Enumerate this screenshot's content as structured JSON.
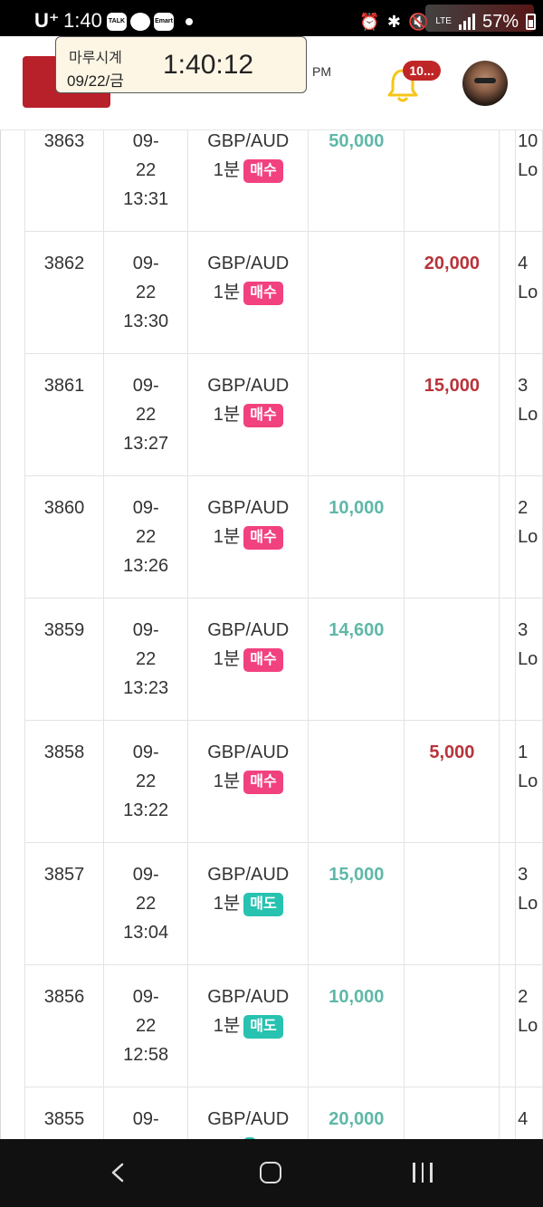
{
  "status_bar": {
    "carrier": "U⁺",
    "time": "1:40",
    "notif_icons": [
      "TALK",
      "",
      "Emart"
    ],
    "network": "LTE",
    "battery": "57%"
  },
  "header": {
    "clock_title": "마루시계",
    "clock_date": "09/22/금",
    "clock_time": "1:40:12",
    "clock_ampm": "PM",
    "notification_count": "10...",
    "accent_color": "#b8202a"
  },
  "table": {
    "rows": [
      {
        "id": "3863",
        "date_line1": "09-",
        "date_line2": "22",
        "time": "13:31",
        "pair": "GBP/AUD",
        "duration": "1분",
        "side": "매수",
        "side_type": "buy",
        "win": "50,000",
        "loss": "",
        "result_line1": "10",
        "result_line2": "Lo"
      },
      {
        "id": "3862",
        "date_line1": "09-",
        "date_line2": "22",
        "time": "13:30",
        "pair": "GBP/AUD",
        "duration": "1분",
        "side": "매수",
        "side_type": "buy",
        "win": "",
        "loss": "20,000",
        "result_line1": "4",
        "result_line2": "Lo"
      },
      {
        "id": "3861",
        "date_line1": "09-",
        "date_line2": "22",
        "time": "13:27",
        "pair": "GBP/AUD",
        "duration": "1분",
        "side": "매수",
        "side_type": "buy",
        "win": "",
        "loss": "15,000",
        "result_line1": "3",
        "result_line2": "Lo"
      },
      {
        "id": "3860",
        "date_line1": "09-",
        "date_line2": "22",
        "time": "13:26",
        "pair": "GBP/AUD",
        "duration": "1분",
        "side": "매수",
        "side_type": "buy",
        "win": "10,000",
        "loss": "",
        "result_line1": "2",
        "result_line2": "Lo"
      },
      {
        "id": "3859",
        "date_line1": "09-",
        "date_line2": "22",
        "time": "13:23",
        "pair": "GBP/AUD",
        "duration": "1분",
        "side": "매수",
        "side_type": "buy",
        "win": "14,600",
        "loss": "",
        "result_line1": "3",
        "result_line2": "Lo"
      },
      {
        "id": "3858",
        "date_line1": "09-",
        "date_line2": "22",
        "time": "13:22",
        "pair": "GBP/AUD",
        "duration": "1분",
        "side": "매수",
        "side_type": "buy",
        "win": "",
        "loss": "5,000",
        "result_line1": "1",
        "result_line2": "Lo"
      },
      {
        "id": "3857",
        "date_line1": "09-",
        "date_line2": "22",
        "time": "13:04",
        "pair": "GBP/AUD",
        "duration": "1분",
        "side": "매도",
        "side_type": "sell",
        "win": "15,000",
        "loss": "",
        "result_line1": "3",
        "result_line2": "Lo"
      },
      {
        "id": "3856",
        "date_line1": "09-",
        "date_line2": "22",
        "time": "12:58",
        "pair": "GBP/AUD",
        "duration": "1분",
        "side": "매도",
        "side_type": "sell",
        "win": "10,000",
        "loss": "",
        "result_line1": "2",
        "result_line2": "Lo"
      },
      {
        "id": "3855",
        "date_line1": "09-",
        "date_line2": "",
        "time": "",
        "pair": "GBP/AUD",
        "duration": "",
        "side": "",
        "side_type": "sell",
        "win": "20,000",
        "loss": "",
        "result_line1": "4",
        "result_line2": ""
      }
    ]
  }
}
